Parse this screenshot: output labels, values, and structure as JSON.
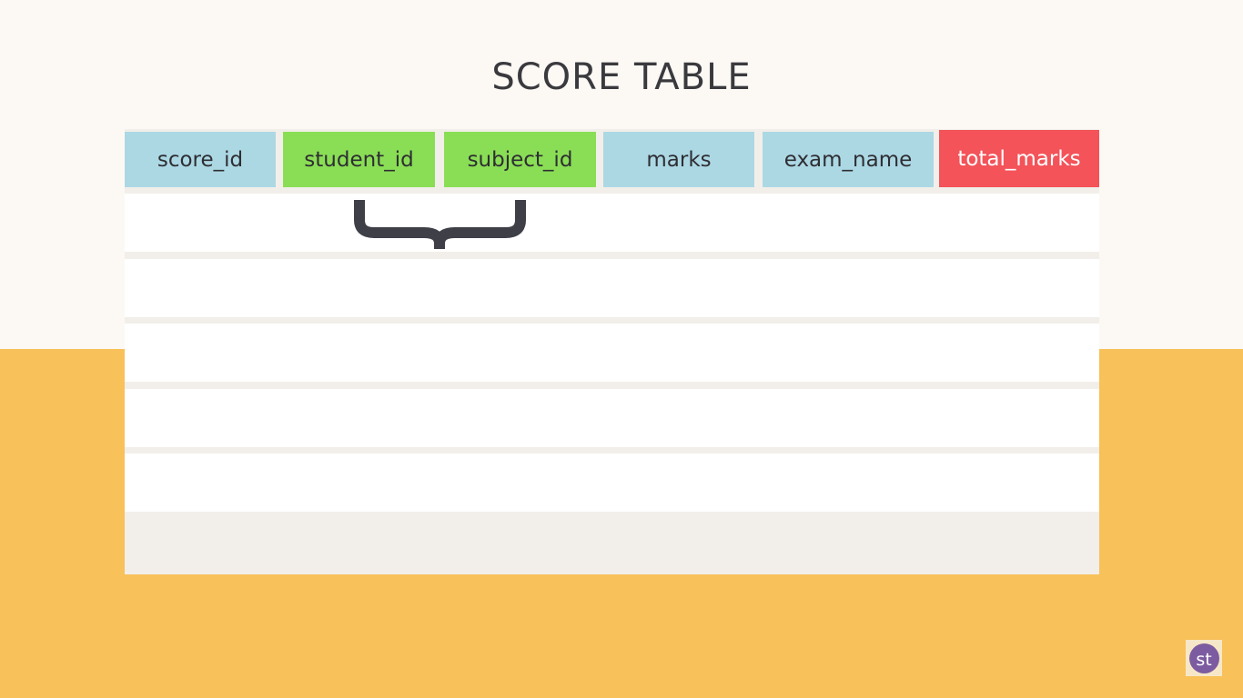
{
  "title": "SCORE TABLE",
  "columns": [
    {
      "label": "score_id",
      "color": "#acd8e4"
    },
    {
      "label": "student_id",
      "color": "#8ade55"
    },
    {
      "label": "subject_id",
      "color": "#8ade55"
    },
    {
      "label": "marks",
      "color": "#acd8e4"
    },
    {
      "label": "exam_name",
      "color": "#acd8e4"
    },
    {
      "label": "total_marks",
      "color": "#f35359",
      "text_color": "#ffffff"
    }
  ],
  "empty_rows": 5,
  "colors": {
    "background_top": "#fcf9f5",
    "background_bottom": "#f8c159",
    "panel": "#f2efea",
    "brace": "#3e3f47",
    "logo": "#7c5ba0"
  },
  "logo": {
    "text": "st"
  }
}
